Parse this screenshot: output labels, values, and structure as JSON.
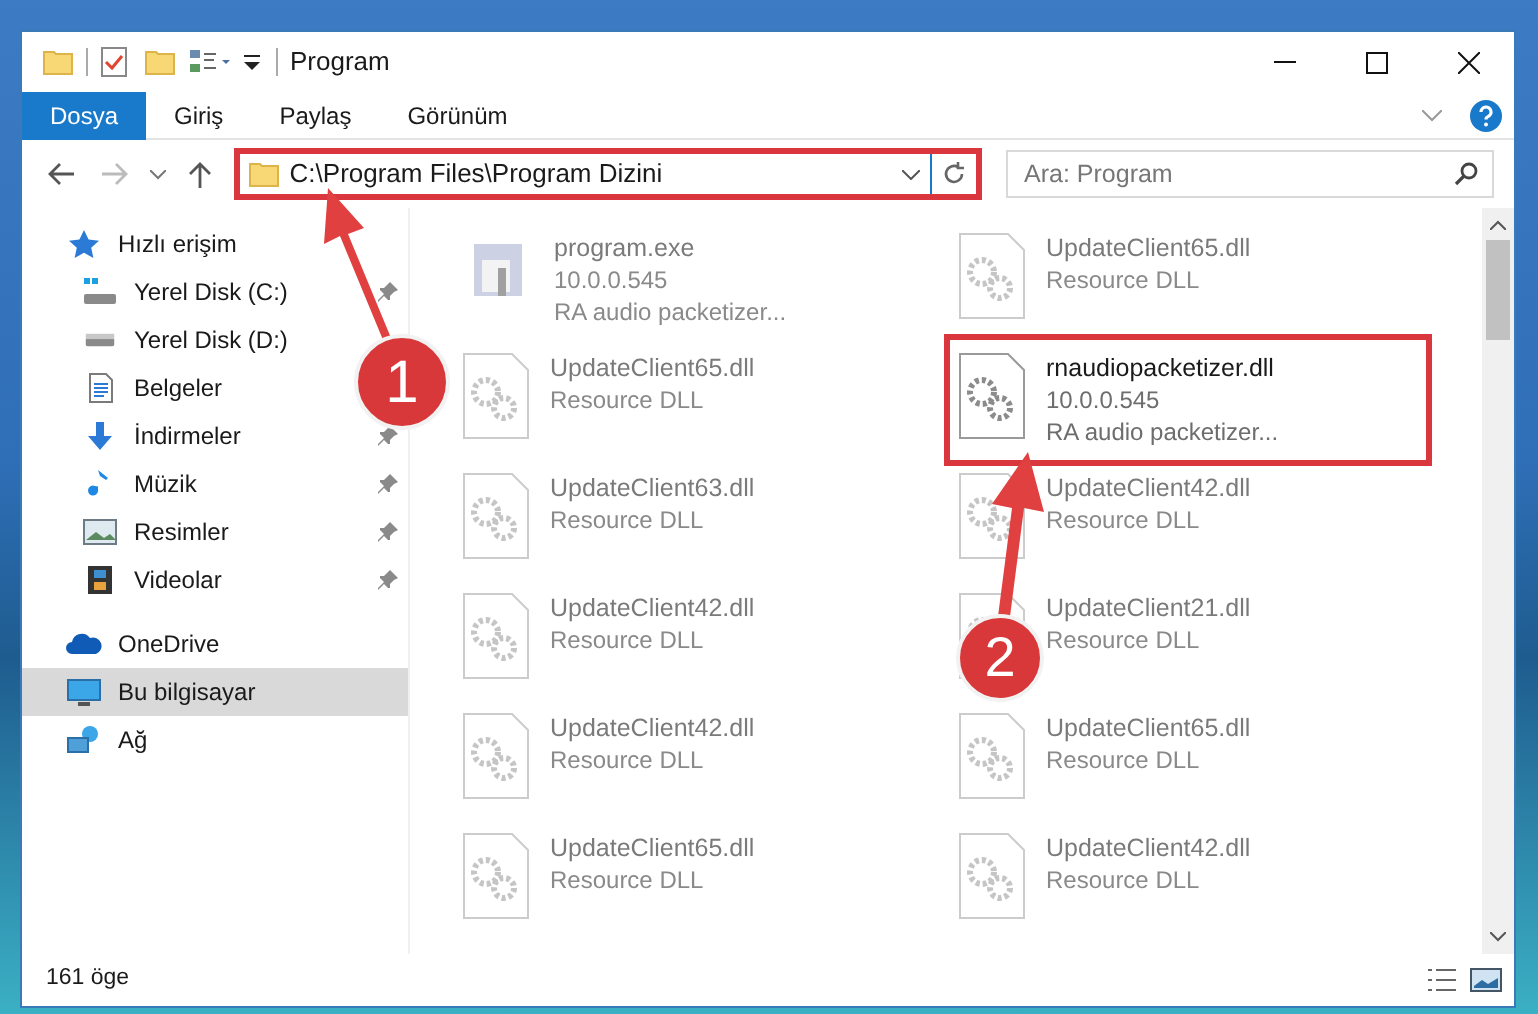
{
  "window": {
    "title": "Program"
  },
  "ribbon": {
    "tabs": [
      {
        "label": "Dosya",
        "kind": "file"
      },
      {
        "label": "Giriş",
        "kind": "tab"
      },
      {
        "label": "Paylaş",
        "kind": "tab"
      },
      {
        "label": "Görünüm",
        "kind": "tab"
      }
    ]
  },
  "address_bar": {
    "path": "C:\\Program Files\\Program Dizini",
    "highlighted": true
  },
  "search": {
    "placeholder": "Ara: Program"
  },
  "sidebar": {
    "items": [
      {
        "label": "Hızlı erişim",
        "kind": "star",
        "selected": false,
        "children": [
          {
            "label": "Yerel Disk (C:)",
            "kind": "drive-c",
            "selected": false,
            "pinned": true
          },
          {
            "label": "Yerel Disk (D:)",
            "kind": "drive",
            "selected": false
          },
          {
            "label": "Belgeler",
            "kind": "docs",
            "selected": false
          },
          {
            "label": "İndirmeler",
            "kind": "download",
            "selected": false,
            "pinned": true
          },
          {
            "label": "Müzik",
            "kind": "music",
            "selected": false,
            "pinned": true
          },
          {
            "label": "Resimler",
            "kind": "pictures",
            "selected": false,
            "pinned": true
          },
          {
            "label": "Videolar",
            "kind": "video",
            "selected": false,
            "pinned": true
          }
        ]
      },
      {
        "label": "OneDrive",
        "kind": "cloud",
        "selected": false
      },
      {
        "label": "Bu bilgisayar",
        "kind": "computer",
        "selected": true
      },
      {
        "label": "Ağ",
        "kind": "network",
        "selected": false
      }
    ]
  },
  "files": [
    {
      "name": "program.exe",
      "lines": [
        "10.0.0.545",
        "RA audio packetizer..."
      ],
      "kind": "exe",
      "highlighted": false
    },
    {
      "name": "UpdateClient65.dll",
      "lines": [
        "Resource DLL"
      ],
      "kind": "dll",
      "highlighted": false
    },
    {
      "name": "UpdateClient65.dll",
      "lines": [
        "Resource DLL"
      ],
      "kind": "dll",
      "highlighted": false
    },
    {
      "name": "rnaudiopacketizer.dll",
      "lines": [
        "10.0.0.545",
        "RA audio packetizer..."
      ],
      "kind": "dll",
      "highlighted": true
    },
    {
      "name": "UpdateClient63.dll",
      "lines": [
        "Resource DLL"
      ],
      "kind": "dll",
      "highlighted": false
    },
    {
      "name": "UpdateClient42.dll",
      "lines": [
        "Resource DLL"
      ],
      "kind": "dll",
      "highlighted": false
    },
    {
      "name": "UpdateClient42.dll",
      "lines": [
        "Resource DLL"
      ],
      "kind": "dll",
      "highlighted": false
    },
    {
      "name": "UpdateClient21.dll",
      "lines": [
        "Resource DLL"
      ],
      "kind": "dll",
      "highlighted": false
    },
    {
      "name": "UpdateClient42.dll",
      "lines": [
        "Resource DLL"
      ],
      "kind": "dll",
      "highlighted": false
    },
    {
      "name": "UpdateClient65.dll",
      "lines": [
        "Resource DLL"
      ],
      "kind": "dll",
      "highlighted": false
    },
    {
      "name": "UpdateClient65.dll",
      "lines": [
        "Resource DLL"
      ],
      "kind": "dll",
      "highlighted": false
    },
    {
      "name": "UpdateClient42.dll",
      "lines": [
        "Resource DLL"
      ],
      "kind": "dll",
      "highlighted": false
    }
  ],
  "annotations": [
    {
      "label": "1"
    },
    {
      "label": "2"
    }
  ],
  "status_bar": {
    "count": "161 öge"
  }
}
